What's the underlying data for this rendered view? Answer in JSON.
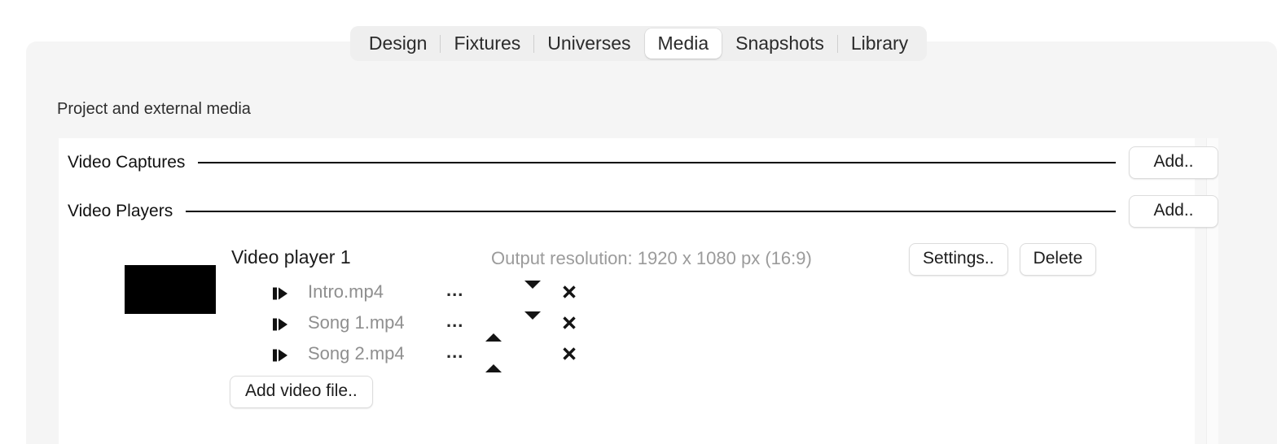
{
  "tabs": [
    {
      "label": "Design",
      "active": false
    },
    {
      "label": "Fixtures",
      "active": false
    },
    {
      "label": "Universes",
      "active": false
    },
    {
      "label": "Media",
      "active": true
    },
    {
      "label": "Snapshots",
      "active": false
    },
    {
      "label": "Library",
      "active": false
    }
  ],
  "panel": {
    "heading": "Project and external media"
  },
  "sections": [
    {
      "label": "Video Captures",
      "add_label": "Add.."
    },
    {
      "label": "Video Players",
      "add_label": "Add.."
    }
  ],
  "player": {
    "title": "Video player 1",
    "resolution": "Output resolution: 1920 x 1080 px (16:9)",
    "settings_label": "Settings..",
    "delete_label": "Delete",
    "add_file_label": "Add video file..",
    "files": [
      {
        "name": "Intro.mp4",
        "menu": "...",
        "can_move_up": false,
        "can_move_down": true
      },
      {
        "name": "Song 1.mp4",
        "menu": "...",
        "can_move_up": true,
        "can_move_down": true
      },
      {
        "name": "Song 2.mp4",
        "menu": "...",
        "can_move_up": true,
        "can_move_down": false
      }
    ]
  },
  "icons": {
    "play": "step-forward-icon",
    "up": "move-up-icon",
    "down": "move-down-icon",
    "remove": "remove-icon"
  },
  "colors": {
    "page_bg": "#ffffff",
    "panel_bg": "#f5f5f5",
    "content_bg": "#ffffff",
    "tabbar_bg": "#efefef",
    "active_tab_bg": "#ffffff",
    "rule": "#000000",
    "muted_text": "#8f8f8f",
    "thumbnail": "#000000"
  }
}
